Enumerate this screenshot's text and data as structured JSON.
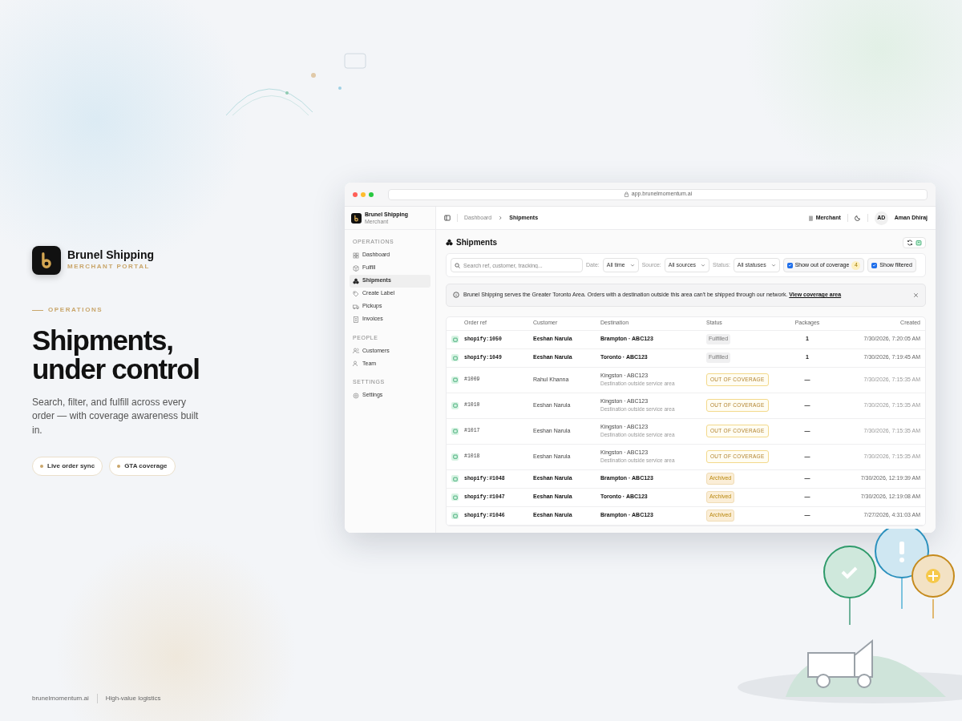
{
  "brand": {
    "name": "Brunel Shipping",
    "subtitle": "MERCHANT PORTAL"
  },
  "eyebrow": "OPERATIONS",
  "headline": "Shipments, under control",
  "description": "Search, filter, and fulfill across every order — with coverage awareness built in.",
  "chips": [
    {
      "label": "Live order sync"
    },
    {
      "label": "GTA coverage"
    }
  ],
  "footer": [
    "brunelmomentum.ai",
    "High-value logistics"
  ],
  "app": {
    "url": "app.brunelmomentum.ai",
    "sidebar": {
      "name": "Brunel Shipping",
      "role": "Merchant",
      "sections": [
        {
          "title": "OPERATIONS",
          "items": [
            {
              "label": "Dashboard",
              "selected": false
            },
            {
              "label": "Fulfill",
              "selected": false
            },
            {
              "label": "Shipments",
              "selected": true
            },
            {
              "label": "Create Label",
              "selected": false
            },
            {
              "label": "Pickups",
              "selected": false
            },
            {
              "label": "Invoices",
              "selected": false
            }
          ]
        },
        {
          "title": "PEOPLE",
          "items": [
            {
              "label": "Customers",
              "selected": false
            },
            {
              "label": "Team",
              "selected": false
            }
          ]
        },
        {
          "title": "SETTINGS",
          "items": [
            {
              "label": "Settings",
              "selected": false
            }
          ]
        }
      ]
    },
    "breadcrumb": [
      "Dashboard",
      "Shipments"
    ],
    "topbar": {
      "workspace": "Merchant",
      "initials": "AD",
      "user": "Aman Dhiraj"
    },
    "page_title": "Shipments",
    "filters": {
      "search_placeholder": "Search ref, customer, tracking...",
      "selects": [
        {
          "label": "Date:",
          "value": "All time"
        },
        {
          "label": "Source:",
          "value": "All sources"
        },
        {
          "label": "Status:",
          "value": "All statuses"
        }
      ],
      "checkboxes": [
        {
          "label": "Show out of coverage",
          "checked": true,
          "count": "4"
        },
        {
          "label": "Show filtered",
          "checked": true
        }
      ]
    },
    "notice": {
      "text": "Brunel Shipping serves the Greater Toronto Area. Orders with a destination outside this area can't be shipped through our network.",
      "link": "View coverage area"
    },
    "table": {
      "columns": [
        "Order ref",
        "Customer",
        "Destination",
        "Status",
        "Packages",
        "Created"
      ],
      "rows": [
        {
          "order_ref": "shopify:1050",
          "customer": "Eeshan Narula",
          "destination": "Brampton · ABC123",
          "status": {
            "label": "Fulfilled",
            "kind": "fulfilled"
          },
          "packages": "1",
          "created": "7/30/2026, 7:20:05 AM"
        },
        {
          "order_ref": "shopify:1049",
          "customer": "Eeshan Narula",
          "destination": "Toronto · ABC123",
          "status": {
            "label": "Fulfilled",
            "kind": "fulfilled"
          },
          "packages": "1",
          "created": "7/30/2026, 7:19:45 AM"
        },
        {
          "order_ref": "#1009",
          "customer": "Rahul Khanna",
          "destination": "Kingston · ABC123",
          "note": "Destination outside service area",
          "status": {
            "label": "OUT OF COVERAGE",
            "kind": "out_of_coverage"
          },
          "packages": "—",
          "created": "7/30/2026, 7:15:35 AM"
        },
        {
          "order_ref": "#1010",
          "customer": "Eeshan Narula",
          "destination": "Kingston · ABC123",
          "note": "Destination outside service area",
          "status": {
            "label": "OUT OF COVERAGE",
            "kind": "out_of_coverage"
          },
          "packages": "—",
          "created": "7/30/2026, 7:15:35 AM"
        },
        {
          "order_ref": "#1017",
          "customer": "Eeshan Narula",
          "destination": "Kingston · ABC123",
          "note": "Destination outside service area",
          "status": {
            "label": "OUT OF COVERAGE",
            "kind": "out_of_coverage"
          },
          "packages": "—",
          "created": "7/30/2026, 7:15:35 AM"
        },
        {
          "order_ref": "#1018",
          "customer": "Eeshan Narula",
          "destination": "Kingston · ABC123",
          "note": "Destination outside service area",
          "status": {
            "label": "OUT OF COVERAGE",
            "kind": "out_of_coverage"
          },
          "packages": "—",
          "created": "7/30/2026, 7:15:35 AM"
        },
        {
          "order_ref": "shopify:#1048",
          "customer": "Eeshan Narula",
          "destination": "Brampton · ABC123",
          "status": {
            "label": "Archived",
            "kind": "archived"
          },
          "packages": "—",
          "created": "7/30/2026, 12:19:39 AM"
        },
        {
          "order_ref": "shopify:#1047",
          "customer": "Eeshan Narula",
          "destination": "Toronto · ABC123",
          "status": {
            "label": "Archived",
            "kind": "archived"
          },
          "packages": "—",
          "created": "7/30/2026, 12:19:08 AM"
        },
        {
          "order_ref": "shopify:#1046",
          "customer": "Eeshan Narula",
          "destination": "Brampton · ABC123",
          "status": {
            "label": "Archived",
            "kind": "archived"
          },
          "packages": "—",
          "created": "7/27/2026, 4:31:03 AM"
        }
      ]
    }
  }
}
